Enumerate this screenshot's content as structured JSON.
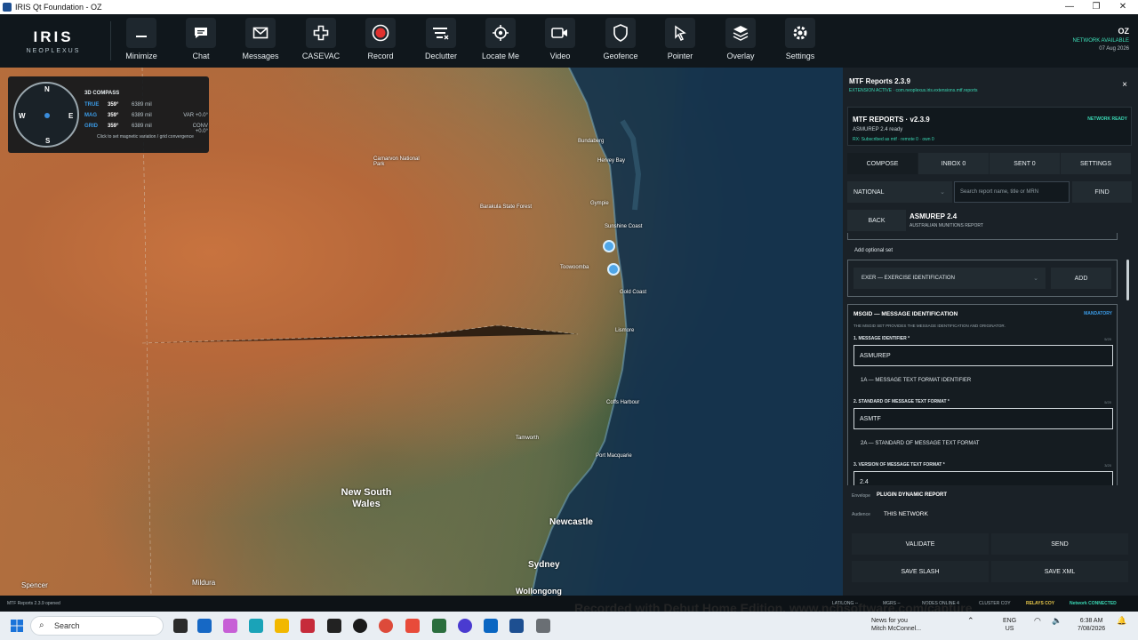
{
  "window": {
    "title": "IRIS Qt Foundation - OZ",
    "controls": [
      "—",
      "❐",
      "✕"
    ]
  },
  "brand": {
    "name": "IRIS",
    "sub": "NEOPLEXUS"
  },
  "toolbar": {
    "items": [
      {
        "label": "Minimize",
        "icon": "minimize-icon"
      },
      {
        "label": "Chat",
        "icon": "chat-icon"
      },
      {
        "label": "Messages",
        "icon": "mail-icon"
      },
      {
        "label": "CASEVAC",
        "icon": "medical-cross-icon"
      },
      {
        "label": "Record",
        "icon": "record-icon"
      },
      {
        "label": "Declutter",
        "icon": "declutter-icon"
      },
      {
        "label": "Locate Me",
        "icon": "crosshair-icon"
      },
      {
        "label": "Video",
        "icon": "video-icon"
      },
      {
        "label": "Geofence",
        "icon": "shield-icon"
      },
      {
        "label": "Pointer",
        "icon": "pointer-icon"
      },
      {
        "label": "Overlay",
        "icon": "layers-icon"
      },
      {
        "label": "Settings",
        "icon": "gear-icon"
      }
    ],
    "status": {
      "region": "OZ",
      "network": "NETWORK AVAILABLE",
      "date": "07 Aug 2026"
    }
  },
  "compass": {
    "title": "3D COMPASS",
    "cardinals": {
      "n": "N",
      "s": "S",
      "e": "E",
      "w": "W"
    },
    "rows": [
      {
        "key": "TRUE",
        "deg": "359°",
        "mil": "6389 mil",
        "extra": ""
      },
      {
        "key": "MAG",
        "deg": "359°",
        "mil": "6389 mil",
        "extra": "VAR +0.0°"
      },
      {
        "key": "GRID",
        "deg": "359°",
        "mil": "6389 mil",
        "extra": "CONV +0.0°"
      }
    ],
    "hint": "Click to set magnetic variation / grid convergence"
  },
  "map": {
    "region_label": "New South Wales",
    "cities": [
      "Newcastle",
      "Sydney",
      "Wollongong",
      "Mildura",
      "Spencer"
    ],
    "small_labels": [
      "Bundaberg",
      "Hervey Bay",
      "Gympie",
      "Sunshine Coast",
      "Toowoomba",
      "Gold Coast",
      "Lismore",
      "Coffs Harbour",
      "Tamworth",
      "Port Macquarie",
      "Carnarvon National Park",
      "Barakula State Forest"
    ]
  },
  "panel": {
    "title": "MTF Reports 2.3.9",
    "subtitle": "EXTENSION ACTIVE · com.neoplexus.iris.extensions.mtf.reports",
    "close": "×",
    "card": {
      "title": "MTF REPORTS · v2.3.9",
      "status": "NETWORK READY",
      "line1": "ASMUREP 2.4 ready",
      "line2": "RX: Subscribed as mtf · remote 0 · own 0"
    },
    "tabs": [
      "COMPOSE",
      "INBOX 0",
      "SENT 0",
      "SETTINGS"
    ],
    "filter": {
      "value": "NATIONAL",
      "search_placeholder": "Search report name, title or MRN",
      "find": "FIND"
    },
    "back": "BACK",
    "report": {
      "name": "ASMUREP 2.4",
      "desc": "AUSTRALIAN MUNITIONS REPORT"
    },
    "optional": {
      "label": "Add optional set",
      "selected": "EXER — EXERCISE IDENTIFICATION",
      "add": "ADD"
    },
    "set": {
      "title": "MSGID — MESSAGE IDENTIFICATION",
      "badge": "MANDATORY",
      "desc": "THE MSGID SET PROVIDES THE MESSAGE IDENTIFICATION AND ORIGINATOR.",
      "fields": [
        {
          "label": "1. MESSAGE IDENTIFIER *",
          "count": "5/20",
          "value": "ASMUREP",
          "sub": "1A — MESSAGE TEXT FORMAT IDENTIFIER"
        },
        {
          "label": "2. STANDARD OF MESSAGE TEXT FORMAT *",
          "count": "5/20",
          "value": "ASMTF",
          "sub": "2A — STANDARD OF MESSAGE TEXT FORMAT"
        },
        {
          "label": "3. VERSION OF MESSAGE TEXT FORMAT *",
          "count": "3/20",
          "value": "2.4",
          "sub": ""
        }
      ]
    },
    "envelope": {
      "label": "Envelope",
      "value": "PLUGIN DYNAMIC REPORT",
      "audience_label": "Audience",
      "audience": "THIS NETWORK"
    },
    "actions": [
      "VALIDATE",
      "SEND",
      "SAVE SLASH",
      "SAVE XML"
    ]
  },
  "statusbar": {
    "left": "MTF Reports 2.3.9 opened",
    "latlong": "LAT/LONG --",
    "mgrs": "MGRS --",
    "nodes": "NODES ONLINE 4",
    "cluster": "CLUSTER COY",
    "relays": "RELAYS COY",
    "network": "Network CONNECTED"
  },
  "watermark": "Recorded with Debut Home Edition. www.nchsoftware.com/capture",
  "taskbar": {
    "search": "Search",
    "news_title": "News for you",
    "news_sub": "Mitch McConnel...",
    "lang": "ENG",
    "region": "US",
    "time": "6:38 AM",
    "date": "7/08/2026"
  }
}
